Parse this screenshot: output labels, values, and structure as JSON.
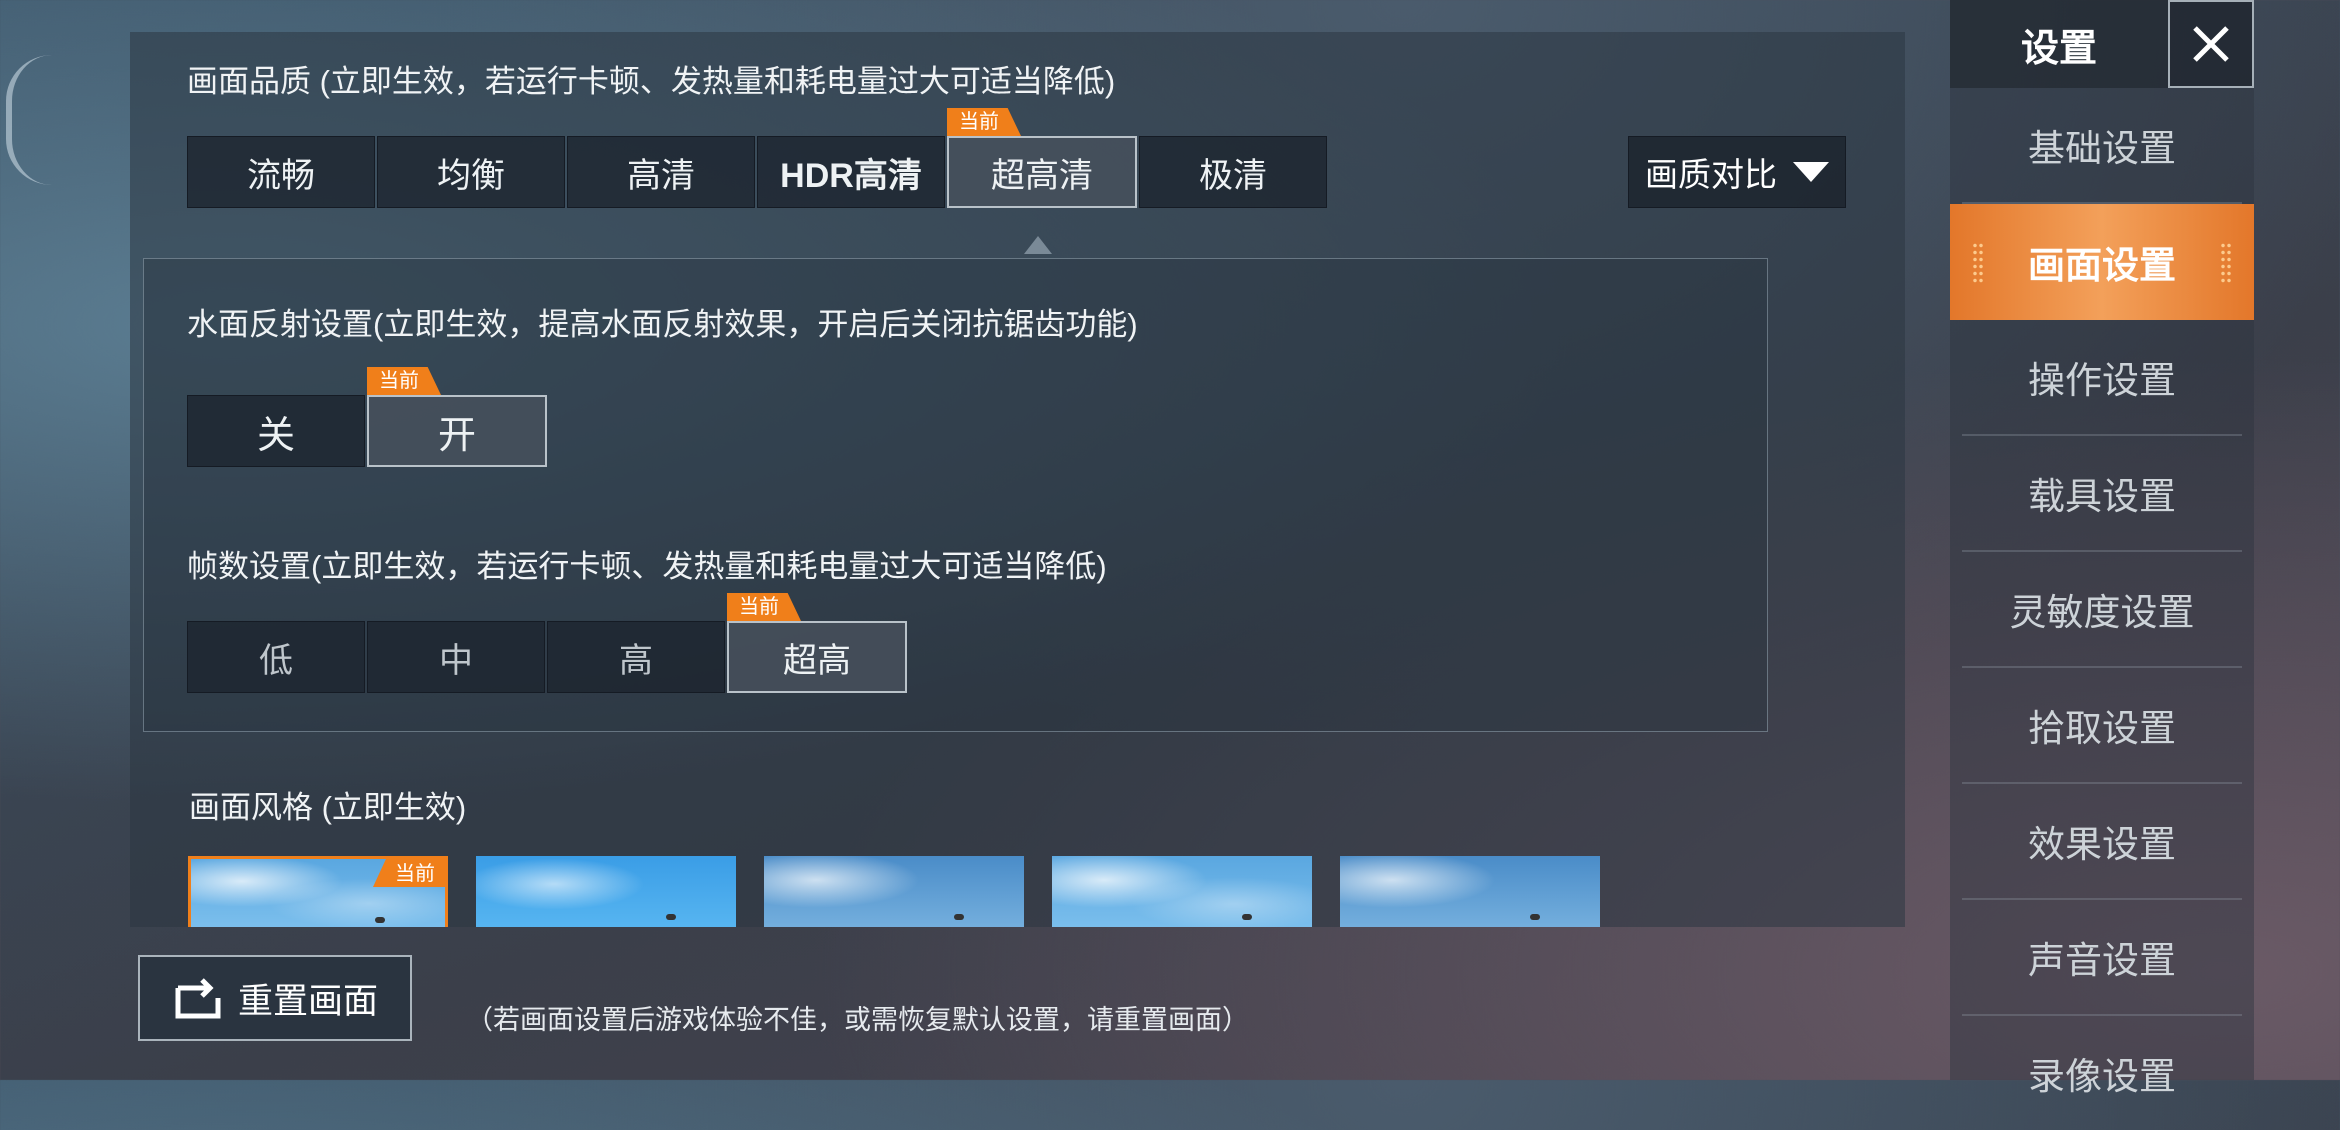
{
  "quality": {
    "title": "画面品质 (立即生效，若运行卡顿、发热量和耗电量过大可适当降低)",
    "options": [
      "流畅",
      "均衡",
      "高清",
      "HDR高清",
      "超高清",
      "极清"
    ],
    "selected": "超高清",
    "compare_label": "画质对比"
  },
  "current_tag": "当前",
  "water": {
    "title": "水面反射设置(立即生效，提高水面反射效果，开启后关闭抗锯齿功能)",
    "options": [
      "关",
      "开"
    ],
    "selected": "开"
  },
  "fps": {
    "title": "帧数设置(立即生效，若运行卡顿、发热量和耗电量过大可适当降低)",
    "options": [
      "低",
      "中",
      "高",
      "超高"
    ],
    "selected": "超高"
  },
  "style": {
    "title": "画面风格 (立即生效)"
  },
  "reset": {
    "label": "重置画面",
    "note": "（若画面设置后游戏体验不佳，或需恢复默认设置，请重置画面）"
  },
  "sidebar": {
    "header": "设置",
    "items": [
      "基础设置",
      "画面设置",
      "操作设置",
      "载具设置",
      "灵敏度设置",
      "拾取设置",
      "效果设置",
      "声音设置",
      "录像设置"
    ],
    "active": "画面设置"
  },
  "colors": {
    "accent": "#f07f1a",
    "active_tab": "#e9842f"
  }
}
